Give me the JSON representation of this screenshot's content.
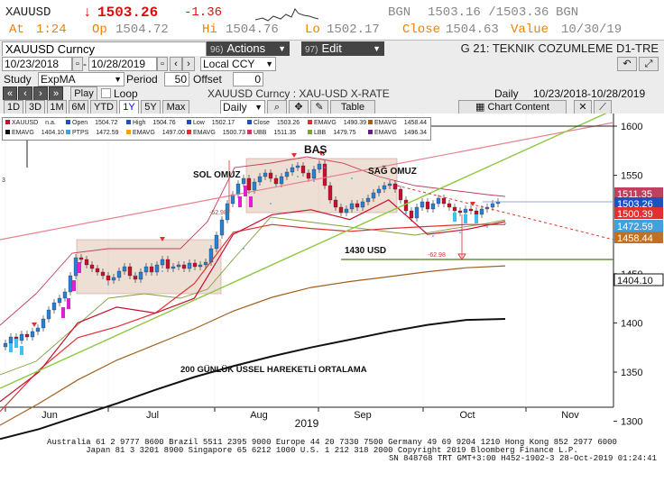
{
  "quote": {
    "ticker": "XAUUSD",
    "arrow": "↓",
    "last": "1503.26",
    "change": "-1.36",
    "bgn1": "BGN",
    "bid_ask": "1503.16 /1503.36",
    "bgn2": "BGN",
    "at_label": "At",
    "at_value": "1:24",
    "op_label": "Op",
    "op_value": "1504.72",
    "hi_label": "Hi",
    "hi_value": "1504.76",
    "lo_label": "Lo",
    "lo_value": "1502.17",
    "close_label": "Close",
    "close_value": "1504.63",
    "value_label": "Value",
    "value_value": "10/30/19"
  },
  "security": {
    "name": "XAUUSD  Curncy",
    "actions_num": "96)",
    "actions_label": "Actions",
    "edit_num": "97)",
    "edit_label": "Edit",
    "right_title": "G 21: TEKNIK COZUMLEME D1-TRE"
  },
  "controls": {
    "start_date": "10/23/2018",
    "dash": "-",
    "end_date": "10/28/2019",
    "currency": "Local CCY",
    "study_label": "Study",
    "study_value": "ExpMA",
    "period_label": "Period",
    "period_value": "50",
    "offset_label": "Offset",
    "offset_value": "0",
    "play": "Play",
    "loop": "Loop",
    "rate_title": "XAUUSD  Curncy : XAU-USD X-RATE",
    "range_label": "Daily",
    "range_value": "10/23/2018-10/28/2019",
    "periods": [
      "1D",
      "3D",
      "1M",
      "6M",
      "YTD",
      "1Y",
      "5Y",
      "Max"
    ],
    "selected_period": "1Y",
    "frequency": "Daily",
    "table": "Table",
    "chart_content": "Chart Content"
  },
  "legend": [
    {
      "name": "XAUUSD",
      "value": "n.a.",
      "color": "#c8102e"
    },
    {
      "name": "Open",
      "value": "1504.72",
      "color": "#2050c0"
    },
    {
      "name": "High",
      "value": "1504.76",
      "color": "#2050c0"
    },
    {
      "name": "Low",
      "value": "1502.17",
      "color": "#2050c0"
    },
    {
      "name": "Close",
      "value": "1503.26",
      "color": "#2050c0"
    },
    {
      "name": "EMAVG",
      "value": "1490.39",
      "color": "#e03030"
    },
    {
      "name": "EMAVG",
      "value": "1458.44",
      "color": "#a06020"
    },
    {
      "name": "EMAVG",
      "value": "1404.10",
      "color": "#111111"
    },
    {
      "name": "PTPS",
      "value": "1472.59",
      "color": "#40a0e0"
    },
    {
      "name": "EMAVG",
      "value": "1497.00",
      "color": "#f0a020"
    },
    {
      "name": "EMAVG",
      "value": "1500.73",
      "color": "#e03030"
    },
    {
      "name": "UBB",
      "value": "1511.35",
      "color": "#c04060"
    },
    {
      "name": "LBB",
      "value": "1479.75",
      "color": "#80a040"
    },
    {
      "name": "EMAVG",
      "value": "1496.34",
      "color": "#602080"
    }
  ],
  "annotations": {
    "bas": "BAŞ",
    "sol_omuz": "SOL OMUZ",
    "sag_omuz": "SAĞ OMUZ",
    "support": "1430 USD",
    "ema200": "200 GÜNLÜK ÜSSEL HAREKETLİ ORTALAMA",
    "neg1": "-62.98",
    "neg2": "-62.98",
    "small3": "3"
  },
  "chart_data": {
    "type": "line",
    "xlabel": "2019",
    "months": [
      "Jun",
      "Jul",
      "Aug",
      "Sep",
      "Oct",
      "Nov"
    ],
    "yticks": [
      "1600",
      "1550",
      "1450",
      "1400",
      "1350",
      "1300"
    ],
    "ylim": [
      1260,
      1610
    ],
    "price_tags": [
      {
        "value": "1511.35",
        "color": "#c04060"
      },
      {
        "value": "1503.26",
        "color": "#2050c0"
      },
      {
        "value": "1500.39",
        "color": "#e03030"
      },
      {
        "value": "1472.59",
        "color": "#40a0e0"
      },
      {
        "value": "1458.44",
        "color": "#c07020"
      },
      {
        "value": "1404.10",
        "color": "#111111"
      }
    ],
    "series": [
      {
        "name": "EMAVG",
        "color": "#111111",
        "values": [
          1282,
          1292,
          1305,
          1318,
          1332,
          1345,
          1356,
          1366,
          1375,
          1383,
          1391,
          1398,
          1403,
          1404
        ]
      },
      {
        "name": "EMAVG",
        "color": "#a06020",
        "values": [
          1296,
          1318,
          1342,
          1362,
          1378,
          1394,
          1412,
          1426,
          1436,
          1442,
          1447,
          1452,
          1456,
          1458
        ]
      },
      {
        "name": "EMAVG",
        "color": "#e03030",
        "values": [
          1310,
          1352,
          1385,
          1396,
          1410,
          1440,
          1492,
          1500,
          1496,
          1493,
          1496,
          1498,
          1500,
          1500
        ]
      },
      {
        "name": "XAUUSD",
        "color": "#c8102e",
        "values": [
          1320,
          1350,
          1400,
          1416,
          1410,
          1425,
          1490,
          1510,
          1515,
          1505,
          1525,
          1490,
          1495,
          1503
        ]
      }
    ]
  },
  "footer": {
    "line1": "Australia 61 2 9777 8600 Brazil 5511 2395 9000 Europe 44 20 7330 7500 Germany 49 69 9204 1210 Hong Kong 852 2977 6000",
    "line2": "Japan 81 3 3201 8900      Singapore 65 6212 1000      U.S. 1 212 318 2000        Copyright 2019 Bloomberg Finance L.P.",
    "line3": "SN 848768 TRT  GMT+3:00 H452-1902-3 28-Oct-2019 01:24:41"
  }
}
